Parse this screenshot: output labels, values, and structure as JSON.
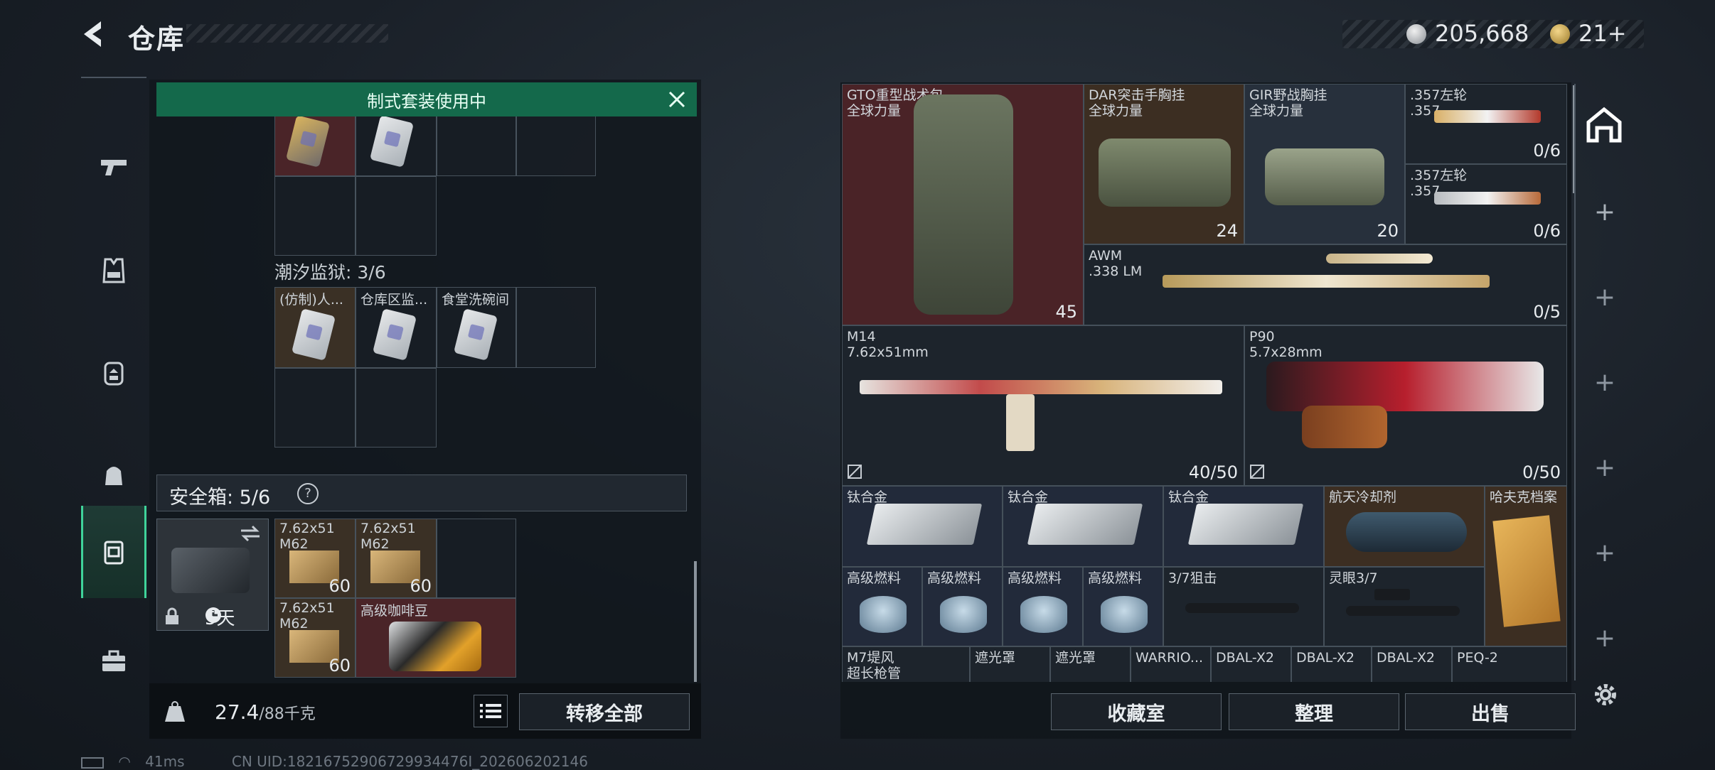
{
  "header": {
    "title": "仓库",
    "currency_silver": "205,668",
    "currency_gold": "21+"
  },
  "left_panel": {
    "suit_banner": "制式套装使用中",
    "prison_section": "潮汐监狱: 3/6",
    "prison_items": [
      {
        "label": "(仿制)人..."
      },
      {
        "label": "仓库区监..."
      },
      {
        "label": "食堂洗碗间"
      }
    ],
    "safebox": {
      "label": "安全箱: 5/6",
      "help": "?",
      "days": "5天",
      "items": [
        {
          "label": "7.62x51\nM62",
          "qty": "60"
        },
        {
          "label": "7.62x51\nM62",
          "qty": "60"
        },
        {
          "label": "7.62x51\nM62",
          "qty": "60"
        },
        {
          "label": "高级咖啡豆",
          "qty": ""
        }
      ]
    },
    "weight_value": "27.4",
    "weight_cap": "/88千克",
    "transfer_all": "转移全部"
  },
  "storage": {
    "items": [
      {
        "id": "gto",
        "name": "GTO重型战术包\n全球力量",
        "qty": "45"
      },
      {
        "id": "dar",
        "name": "DAR突击手胸挂\n全球力量",
        "qty": "24"
      },
      {
        "id": "gir",
        "name": "GIR野战胸挂\n全球力量",
        "qty": "20"
      },
      {
        "id": "rev1",
        "name": ".357左轮\n.357",
        "qty": "0/6"
      },
      {
        "id": "rev2",
        "name": ".357左轮\n.357",
        "qty": "0/6"
      },
      {
        "id": "awm",
        "name": "AWM\n.338 LM",
        "qty": "0/5"
      },
      {
        "id": "m14",
        "name": "M14\n7.62x51mm",
        "qty": "40/50"
      },
      {
        "id": "p90",
        "name": "P90\n5.7x28mm",
        "qty": "0/50"
      },
      {
        "id": "ti1",
        "name": "钛合金",
        "qty": ""
      },
      {
        "id": "ti2",
        "name": "钛合金",
        "qty": ""
      },
      {
        "id": "ti3",
        "name": "钛合金",
        "qty": ""
      },
      {
        "id": "coolant",
        "name": "航天冷却剂",
        "qty": ""
      },
      {
        "id": "file",
        "name": "哈夫克档案",
        "qty": ""
      },
      {
        "id": "fuel1",
        "name": "高级燃料",
        "qty": ""
      },
      {
        "id": "fuel2",
        "name": "高级燃料",
        "qty": ""
      },
      {
        "id": "fuel3",
        "name": "高级燃料",
        "qty": ""
      },
      {
        "id": "fuel4",
        "name": "高级燃料",
        "qty": ""
      },
      {
        "id": "scope37",
        "name": "3/7狙击",
        "qty": ""
      },
      {
        "id": "spirit",
        "name": "灵眼3/7",
        "qty": ""
      },
      {
        "id": "m7",
        "name": "M7堤风\n超长枪管",
        "qty": ""
      },
      {
        "id": "shade1",
        "name": "遮光罩",
        "qty": ""
      },
      {
        "id": "shade2",
        "name": "遮光罩",
        "qty": ""
      },
      {
        "id": "warrior",
        "name": "WARRIO...",
        "qty": ""
      },
      {
        "id": "dbal1",
        "name": "DBAL-X2",
        "qty": ""
      },
      {
        "id": "dbal2",
        "name": "DBAL-X2",
        "qty": ""
      },
      {
        "id": "dbal3",
        "name": "DBAL-X2",
        "qty": ""
      },
      {
        "id": "peq",
        "name": "PEQ-2",
        "qty": ""
      }
    ]
  },
  "buttons": {
    "collection": "收藏室",
    "organize": "整理",
    "sell": "出售"
  },
  "status": {
    "ping": "41ms",
    "uid": "CN UID:18216752906729934476I_202606202146"
  }
}
